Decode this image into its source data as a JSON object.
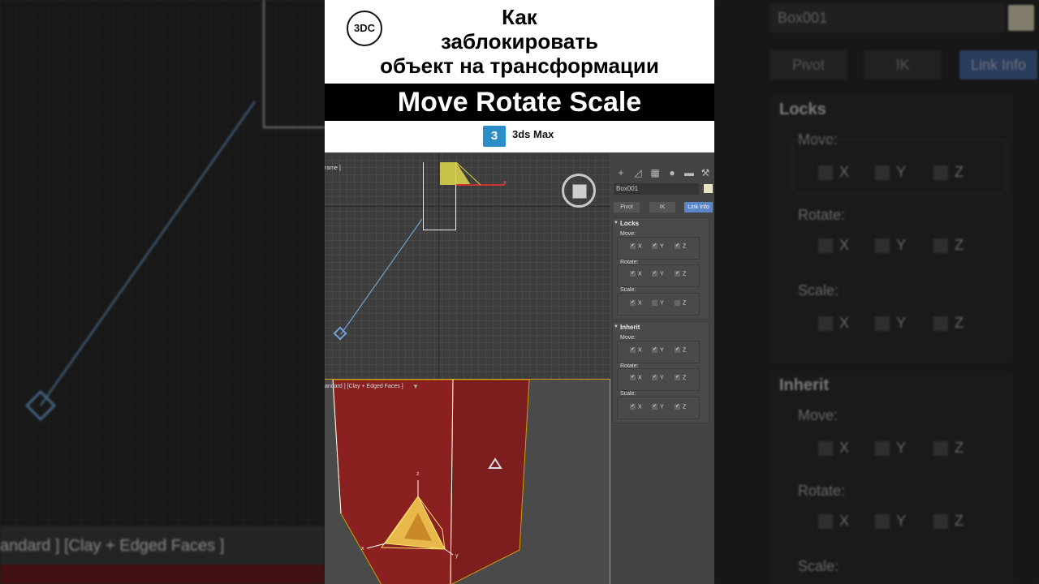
{
  "title": {
    "line1": "Как",
    "line2": "заблокировать",
    "line3": "объект на трансформации"
  },
  "band_text": "Move  Rotate  Scale",
  "logo_text": "3DC",
  "app": {
    "badge": "3",
    "name": "3ds Max"
  },
  "viewport_top": {
    "label": "rame ]",
    "axis_x": "x"
  },
  "viewport_persp": {
    "label": "andard ] [Clay + Edged Faces ]",
    "filter_icon": "funnel-icon",
    "axis_z": "z",
    "axis_x": "x",
    "axis_y": "y"
  },
  "command_panel": {
    "tab_icons": [
      "create-icon",
      "modify-icon",
      "hierarchy-icon",
      "motion-icon",
      "display-icon",
      "utilities-icon"
    ],
    "object_name": "Box001",
    "object_color": "#ece3c2",
    "buttons": {
      "pivot": "Pivot",
      "ik": "IK",
      "link_info": "Link Info"
    },
    "locks": {
      "title": "Locks",
      "groups": [
        {
          "label": "Move:",
          "x": "X",
          "y": "Y",
          "z": "Z",
          "checked": [
            true,
            true,
            true
          ]
        },
        {
          "label": "Rotate:",
          "x": "X",
          "y": "Y",
          "z": "Z",
          "checked": [
            true,
            true,
            true
          ]
        },
        {
          "label": "Scale:",
          "x": "X",
          "y": "Y",
          "z": "Z",
          "checked": [
            true,
            false,
            false
          ]
        }
      ]
    },
    "inherit": {
      "title": "Inherit",
      "groups": [
        {
          "label": "Move:",
          "x": "X",
          "y": "Y",
          "z": "Z",
          "checked": [
            true,
            true,
            true
          ]
        },
        {
          "label": "Rotate:",
          "x": "X",
          "y": "Y",
          "z": "Z",
          "checked": [
            true,
            true,
            true
          ]
        },
        {
          "label": "Scale:",
          "x": "X",
          "y": "Y",
          "z": "Z",
          "checked": [
            true,
            true,
            true
          ]
        }
      ]
    }
  },
  "background_right": {
    "object_name": "Box001",
    "buttons": {
      "pivot": "Pivot",
      "ik": "IK",
      "link_info": "Link Info"
    },
    "locks_title": "Locks",
    "inherit_title": "Inherit",
    "move": "Move:",
    "rotate": "Rotate:",
    "scale": "Scale:",
    "x": "X",
    "y": "Y",
    "z": "Z"
  },
  "background_left": {
    "label": "andard ] [Clay + Edged Faces ]"
  },
  "colors": {
    "active_button": "#5b86c9",
    "object_red": "#8b2020",
    "gizmo_yellow": "#e8b84a"
  }
}
